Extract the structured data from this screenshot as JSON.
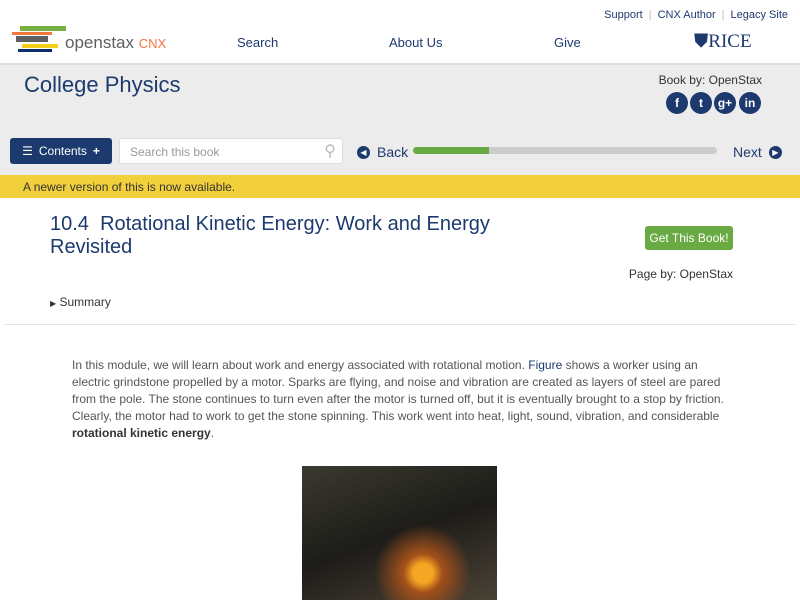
{
  "header": {
    "logo_text": "openstax",
    "logo_suffix": "CNX",
    "nav": [
      "Search",
      "About Us",
      "Give"
    ],
    "top_links": [
      "Support",
      "CNX Author",
      "Legacy Site"
    ],
    "partner": "RICE"
  },
  "book": {
    "title": "College Physics",
    "book_by": "Book by: OpenStax",
    "social": [
      "f",
      "t",
      "g+",
      "in"
    ]
  },
  "toolbar": {
    "contents": "Contents",
    "search_placeholder": "Search this book",
    "back": "Back",
    "next": "Next",
    "progress": 0.25
  },
  "banner": {
    "prefix": "A ",
    "link": "newer version",
    "suffix": " of this is now available."
  },
  "module": {
    "number": "10.4",
    "title": "Rotational Kinetic Energy: Work and Energy Revisited",
    "get_book": "Get This Book!",
    "page_by": "Page by: OpenStax",
    "summary": "Summary"
  },
  "content": {
    "p1": "In this module, we will learn about work and energy associated with rotational motion. ",
    "figure_link": "Figure",
    "p2": " shows a worker using an electric grindstone propelled by a motor. Sparks are flying, and noise and vibration are created as layers of steel are pared from the pole. The stone continues to turn even after the motor is turned off, but it is eventually brought to a stop by friction. Clearly, the motor had to work to get the stone spinning. This work went into heat, light, sound, vibration, and considerable ",
    "bold": "rotational kinetic energy",
    "end": "."
  }
}
